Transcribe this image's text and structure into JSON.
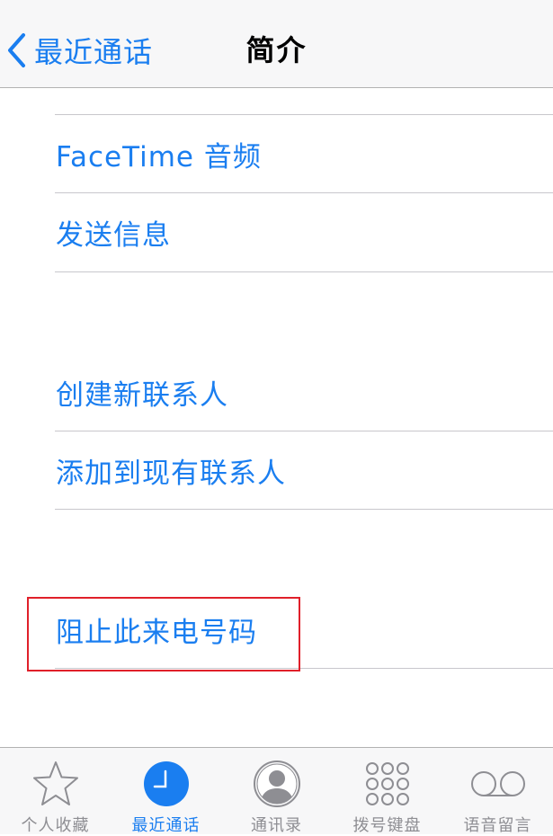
{
  "navbar": {
    "back_label": "最近通话",
    "title": "简介"
  },
  "actions": {
    "facetime_audio": "FaceTime 音频",
    "send_message": "发送信息",
    "create_contact": "创建新联系人",
    "add_to_existing": "添加到现有联系人",
    "block_caller": "阻止此来电号码"
  },
  "tabbar": {
    "items": [
      {
        "label": "个人收藏",
        "icon": "star-icon"
      },
      {
        "label": "最近通话",
        "icon": "clock-icon",
        "active": true
      },
      {
        "label": "通讯录",
        "icon": "person-icon"
      },
      {
        "label": "拨号键盘",
        "icon": "keypad-icon"
      },
      {
        "label": "语音留言",
        "icon": "voicemail-icon"
      }
    ]
  },
  "colors": {
    "accent": "#1a7ef0",
    "highlight": "#e0202a",
    "inactive": "#8e8e93"
  }
}
